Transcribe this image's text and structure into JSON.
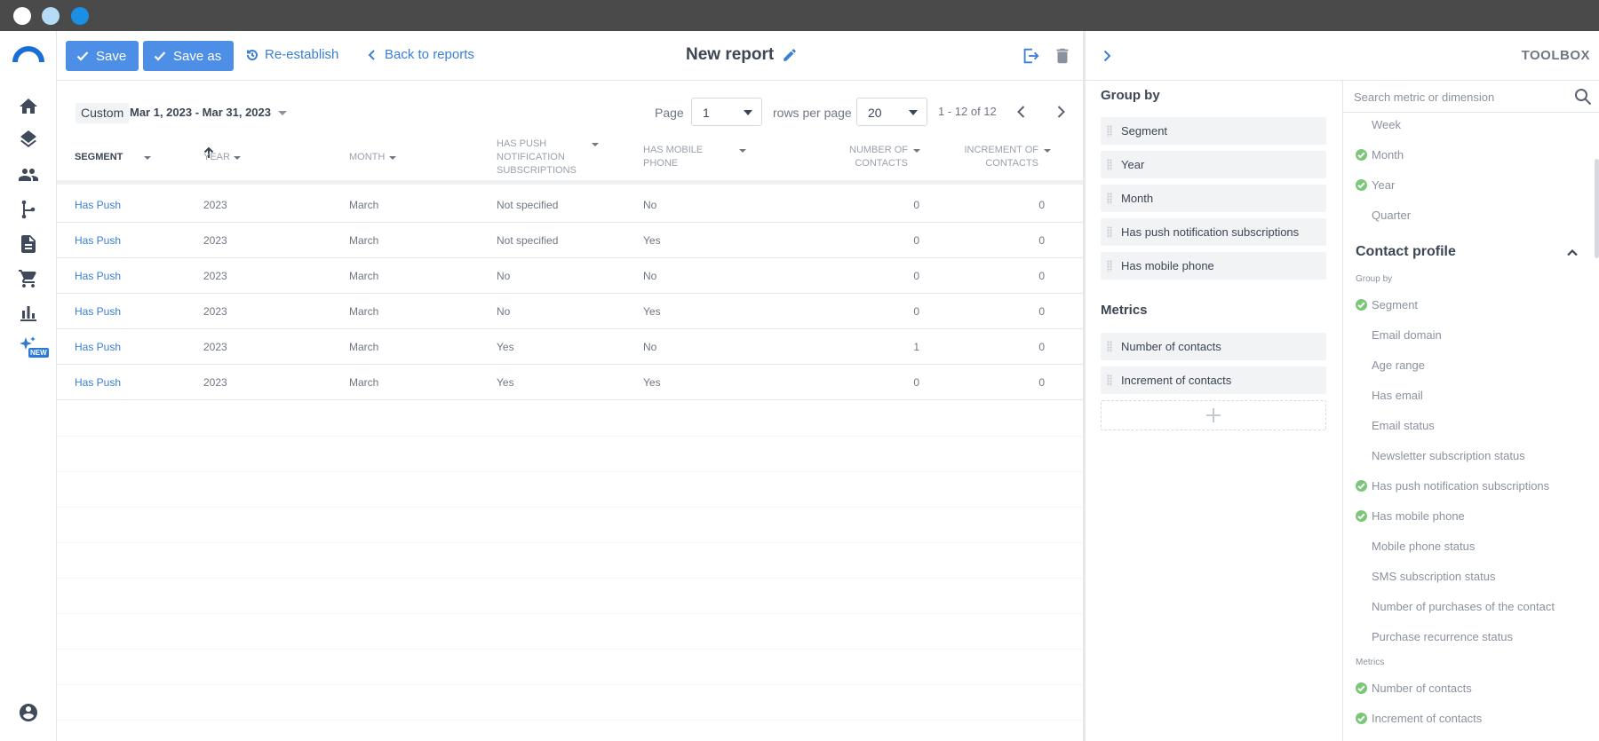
{
  "toolbar": {
    "save_label": "Save",
    "save_as_label": "Save as",
    "reestablish_label": "Re-establish",
    "back_label": "Back to reports",
    "report_title": "New report"
  },
  "filters": {
    "date_type": "Custom",
    "date_range": "Mar 1, 2023 - Mar 31, 2023",
    "page_label": "Page",
    "page_value": "1",
    "rows_label": "rows per page",
    "rows_value": "20",
    "range_text": "1 - 12 of 12"
  },
  "table": {
    "columns": [
      "SEGMENT",
      "YEAR",
      "MONTH",
      "HAS PUSH NOTIFICATION SUBSCRIPTIONS",
      "HAS MOBILE PHONE",
      "NUMBER OF CONTACTS",
      "INCREMENT OF CONTACTS"
    ],
    "rows": [
      [
        "Has Push",
        "2023",
        "March",
        "Not specified",
        "No",
        "0",
        "0"
      ],
      [
        "Has Push",
        "2023",
        "March",
        "Not specified",
        "Yes",
        "0",
        "0"
      ],
      [
        "Has Push",
        "2023",
        "March",
        "No",
        "No",
        "0",
        "0"
      ],
      [
        "Has Push",
        "2023",
        "March",
        "No",
        "Yes",
        "0",
        "0"
      ],
      [
        "Has Push",
        "2023",
        "March",
        "Yes",
        "No",
        "1",
        "0"
      ],
      [
        "Has Push",
        "2023",
        "March",
        "Yes",
        "Yes",
        "0",
        "0"
      ]
    ]
  },
  "toolbox": {
    "title": "TOOLBOX",
    "group_by_title": "Group by",
    "group_by": [
      "Segment",
      "Year",
      "Month",
      "Has push notification subscriptions",
      "Has mobile phone"
    ],
    "metrics_title": "Metrics",
    "metrics": [
      "Number of contacts",
      "Increment of contacts"
    ],
    "search_placeholder": "Search metric or dimension",
    "time_items": [
      {
        "label": "Week",
        "checked": false
      },
      {
        "label": "Month",
        "checked": true
      },
      {
        "label": "Year",
        "checked": true
      },
      {
        "label": "Quarter",
        "checked": false
      }
    ],
    "contact_profile_title": "Contact profile",
    "cp_group_by_label": "Group by",
    "cp_items": [
      {
        "label": "Segment",
        "checked": true
      },
      {
        "label": "Email domain",
        "checked": false
      },
      {
        "label": "Age range",
        "checked": false
      },
      {
        "label": "Has email",
        "checked": false
      },
      {
        "label": "Email status",
        "checked": false
      },
      {
        "label": "Newsletter subscription status",
        "checked": false
      },
      {
        "label": "Has push notification subscriptions",
        "checked": true
      },
      {
        "label": "Has mobile phone",
        "checked": true
      },
      {
        "label": "Mobile phone status",
        "checked": false
      },
      {
        "label": "SMS subscription status",
        "checked": false
      },
      {
        "label": "Number of purchases of the contact",
        "checked": false
      },
      {
        "label": "Purchase recurrence status",
        "checked": false
      }
    ],
    "cp_metrics_label": "Metrics",
    "cp_metrics": [
      {
        "label": "Number of contacts",
        "checked": true
      },
      {
        "label": "Increment of contacts",
        "checked": true
      }
    ]
  },
  "nav": {
    "new_badge": "NEW"
  },
  "colors": {
    "accent": "#4d8fe6",
    "link": "#3a7fd6",
    "check": "#7cc67a",
    "titlebar": "#4a4a4a"
  }
}
